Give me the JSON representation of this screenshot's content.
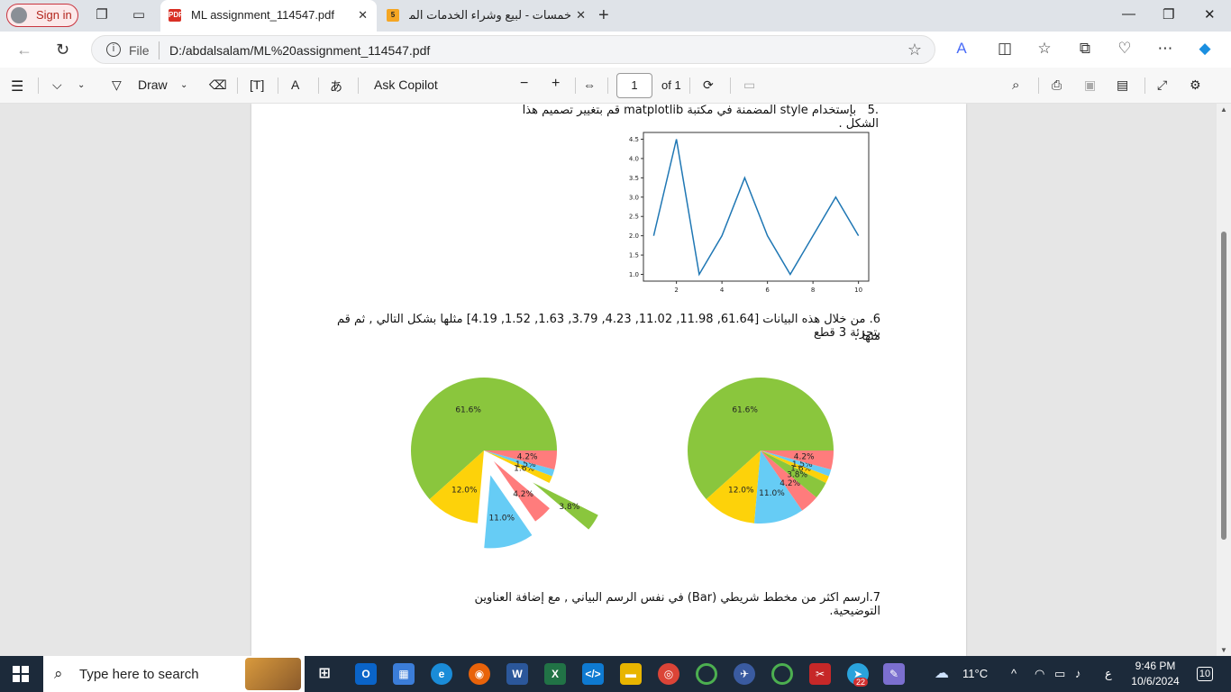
{
  "browser": {
    "sign_in": "Sign in",
    "tabs": [
      {
        "title": "ML assignment_114547.pdf",
        "favicon": "PDF"
      },
      {
        "title": "خمسات - لبيع وشراء الخدمات المصغرة",
        "favicon": "5"
      }
    ],
    "address": {
      "label": "File",
      "url": "D:/abdalsalam/ML%20assignment_114547.pdf"
    }
  },
  "pdf_toolbar": {
    "draw_label": "Draw",
    "copilot_label": "Ask Copilot",
    "page_number": "1",
    "page_total": "of 1"
  },
  "document": {
    "q5_number": ".5",
    "q5_text": "بإستخدام style المضمنة في مكتبة matplotlib قم بتغيير تصميم هذا الشكل .",
    "q6_text_line1": "6. من خلال هذه البيانات  [61.64, 11.98, 11.02, 4.23, 3.79, 1.63, 1.52, 4.19] مثلها بشكل التالي , ثم قم بتجزئة 3 قطع",
    "q6_text_line2": "منها .",
    "q7_text": "7.ارسم اكثر من مخطط شريطي (Bar) في نفس الرسم البياني , مع إضافة العناوين التوضيحية."
  },
  "chart_data": [
    {
      "type": "line",
      "x": [
        1,
        2,
        3,
        4,
        5,
        6,
        7,
        8,
        9,
        10
      ],
      "y": [
        2.0,
        4.5,
        1.0,
        2.0,
        3.5,
        2.0,
        1.0,
        2.0,
        3.0,
        2.0
      ],
      "xticks": [
        "2",
        "4",
        "6",
        "8",
        "10"
      ],
      "yticks": [
        "1.0",
        "1.5",
        "2.0",
        "2.5",
        "3.0",
        "3.5",
        "4.0",
        "4.5"
      ],
      "xlim": [
        0.55,
        10.45
      ],
      "ylim": [
        0.825,
        4.675
      ],
      "color": "#1f77b4"
    },
    {
      "type": "pie",
      "name": "exploded",
      "values": [
        61.64,
        11.98,
        11.02,
        4.23,
        3.79,
        1.63,
        1.52,
        4.19
      ],
      "labels": [
        "61.6%",
        "12.0%",
        "11.0%",
        "4.2%",
        "3.8%",
        "1.6%",
        "1.5%",
        "4.2%"
      ],
      "colors": [
        "#8ac63d",
        "#fdd20a",
        "#66ccf5",
        "#ff7c7c",
        "#8ac63d",
        "#fdd20a",
        "#66ccf5",
        "#ff7c7c"
      ],
      "explode": [
        0,
        0,
        0.35,
        0.2,
        0.8,
        0,
        0,
        0
      ]
    },
    {
      "type": "pie",
      "name": "normal",
      "values": [
        61.64,
        11.98,
        11.02,
        4.23,
        3.79,
        1.63,
        1.52,
        4.19
      ],
      "labels": [
        "61.6%",
        "12.0%",
        "11.0%",
        "4.2%",
        "3.8%",
        "1.6%",
        "1.5%",
        "4.2%"
      ],
      "colors": [
        "#8ac63d",
        "#fdd20a",
        "#66ccf5",
        "#ff7c7c",
        "#8ac63d",
        "#fdd20a",
        "#66ccf5",
        "#ff7c7c"
      ],
      "explode": [
        0,
        0,
        0,
        0,
        0,
        0,
        0,
        0
      ]
    }
  ],
  "taskbar": {
    "search_placeholder": "Type here to search",
    "weather": "11°C",
    "lang": "ع",
    "time": "9:46 PM",
    "date": "10/6/2024",
    "notification_count": "10",
    "telegram_badge": "22"
  }
}
